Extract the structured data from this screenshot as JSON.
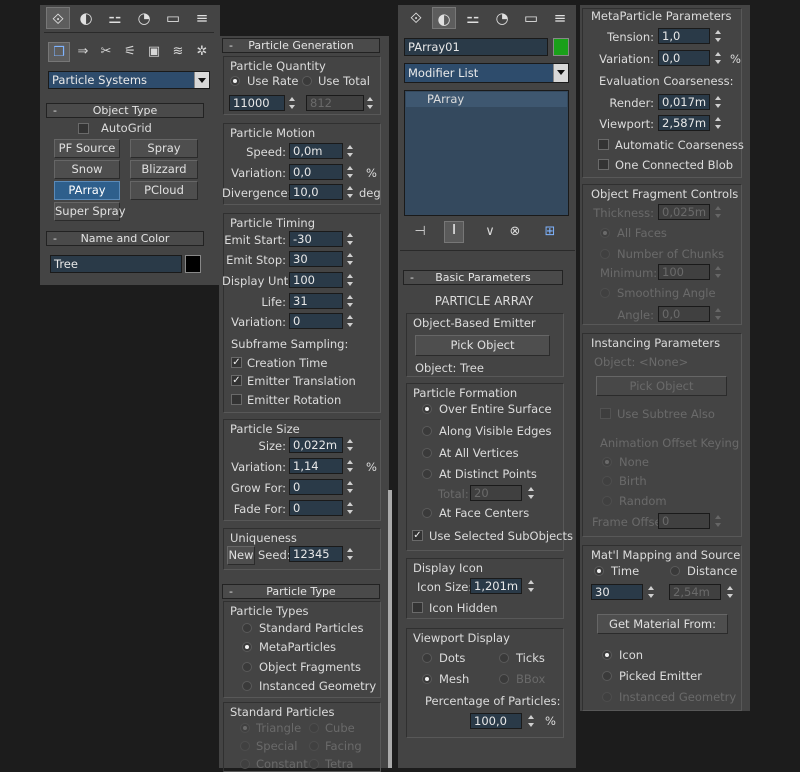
{
  "tabs": {
    "icons": [
      "create-icon",
      "modify-icon",
      "hierarchy-icon",
      "motion-icon",
      "display-icon",
      "utilities-icon"
    ],
    "glyphs": [
      "⟐",
      "◐",
      "⚍",
      "◔",
      "▭",
      "≡"
    ]
  },
  "create": {
    "category_glyphs": [
      "❒",
      "⇒",
      "✂",
      "⚟",
      "▣",
      "≋",
      "✲"
    ],
    "category_icons": [
      "geometry-icon",
      "shapes-icon",
      "lights-icon",
      "cameras-icon",
      "helpers-icon",
      "spacewarps-icon",
      "systems-icon"
    ],
    "dropdown": "Particle Systems",
    "object_type": {
      "title": "Object Type",
      "autogrid": "AutoGrid",
      "buttons": [
        "PF Source",
        "Spray",
        "Snow",
        "Blizzard",
        "PArray",
        "PCloud",
        "Super Spray"
      ]
    },
    "name_color": {
      "title": "Name and Color",
      "name": "Tree",
      "swatch": "#000000"
    }
  },
  "particle_generation": {
    "title": "Particle Generation",
    "quantity": {
      "title": "Particle Quantity",
      "use_rate": "Use Rate",
      "use_total": "Use Total",
      "rate": "11000",
      "total": "812"
    },
    "motion": {
      "title": "Particle Motion",
      "speed_l": "Speed:",
      "speed": "0,0m",
      "var_l": "Variation:",
      "var": "0,0",
      "pct": "%",
      "div_l": "Divergence:",
      "div": "10,0",
      "deg": "deg"
    },
    "timing": {
      "title": "Particle Timing",
      "emit_start_l": "Emit Start:",
      "emit_start": "-30",
      "emit_stop_l": "Emit Stop:",
      "emit_stop": "30",
      "display_until_l": "Display Until:",
      "display_until": "100",
      "life_l": "Life:",
      "life": "31",
      "var_l": "Variation:",
      "var": "0",
      "subframe": "Subframe Sampling:",
      "creation": "Creation Time",
      "emitter_trans": "Emitter Translation",
      "emitter_rot": "Emitter Rotation"
    },
    "size": {
      "title": "Particle Size",
      "size_l": "Size:",
      "size": "0,022m",
      "var_l": "Variation:",
      "var": "1,14",
      "pct": "%",
      "grow_l": "Grow For:",
      "grow": "0",
      "fade_l": "Fade For:",
      "fade": "0"
    },
    "unique": {
      "title": "Uniqueness",
      "new": "New",
      "seed_l": "Seed:",
      "seed": "12345"
    }
  },
  "particle_type": {
    "title": "Particle Type",
    "types_title": "Particle Types",
    "types": [
      "Standard Particles",
      "MetaParticles",
      "Object Fragments",
      "Instanced Geometry"
    ],
    "std_title": "Standard Particles",
    "std": [
      "Triangle",
      "Cube",
      "Special",
      "Facing",
      "Constant",
      "Tetra"
    ]
  },
  "modify": {
    "object_name": "PArray01",
    "object_color": "#1aa01a",
    "modifier_list": "Modifier List",
    "stack_item": "PArray",
    "toolbar_icons": [
      "pin-stack-icon",
      "show-end-result-icon",
      "make-unique-icon",
      "remove-modifier-icon",
      "configure-sets-icon"
    ],
    "toolbar_glyphs": [
      "⊣",
      "Ⅰ",
      "∨",
      "⊗",
      "⊞"
    ]
  },
  "basic": {
    "title": "Basic Parameters",
    "heading": "PARTICLE ARRAY",
    "emitter": {
      "title": "Object-Based Emitter",
      "pick": "Pick Object",
      "object": "Object: Tree"
    },
    "formation": {
      "title": "Particle Formation",
      "opts": [
        "Over Entire Surface",
        "Along Visible Edges",
        "At All Vertices",
        "At Distinct Points",
        "At Face Centers"
      ],
      "total_l": "Total:",
      "total": "20",
      "use_sub": "Use Selected SubObjects"
    },
    "display_icon": {
      "title": "Display Icon",
      "size_l": "Icon Size:",
      "size": "1,201m",
      "hidden": "Icon Hidden"
    },
    "viewport": {
      "title": "Viewport Display",
      "dots": "Dots",
      "ticks": "Ticks",
      "mesh": "Mesh",
      "bbox": "BBox",
      "pct_l": "Percentage of Particles:",
      "pct": "100,0",
      "pct_s": "%"
    }
  },
  "meta": {
    "title": "MetaParticle Parameters",
    "tension_l": "Tension:",
    "tension": "1,0",
    "var_l": "Variation:",
    "var": "0,0",
    "pct": "%",
    "coarse_l": "Evaluation Coarseness:",
    "render_l": "Render:",
    "render": "0,017m",
    "viewport_l": "Viewport:",
    "viewport": "2,587m",
    "auto": "Automatic Coarseness",
    "one_blob": "One Connected Blob"
  },
  "fragment": {
    "title": "Object Fragment Controls",
    "thick_l": "Thickness:",
    "thick": "0,025m",
    "all_faces": "All Faces",
    "chunks": "Number of Chunks",
    "min_l": "Minimum:",
    "min": "100",
    "smooth": "Smoothing Angle",
    "angle_l": "Angle:",
    "angle": "0,0"
  },
  "instancing": {
    "title": "Instancing Parameters",
    "object": "Object: <None>",
    "pick": "Pick Object",
    "subtree": "Use Subtree Also",
    "anim_l": "Animation Offset Keying",
    "none": "None",
    "birth": "Birth",
    "random": "Random",
    "frame_l": "Frame Offset:",
    "frame": "0"
  },
  "matmap": {
    "title": "Mat'l Mapping and Source",
    "time": "Time",
    "distance": "Distance",
    "time_v": "30",
    "dist_v": "2,54m",
    "get": "Get Material From:",
    "icon": "Icon",
    "picked": "Picked Emitter",
    "instanced": "Instanced Geometry"
  }
}
